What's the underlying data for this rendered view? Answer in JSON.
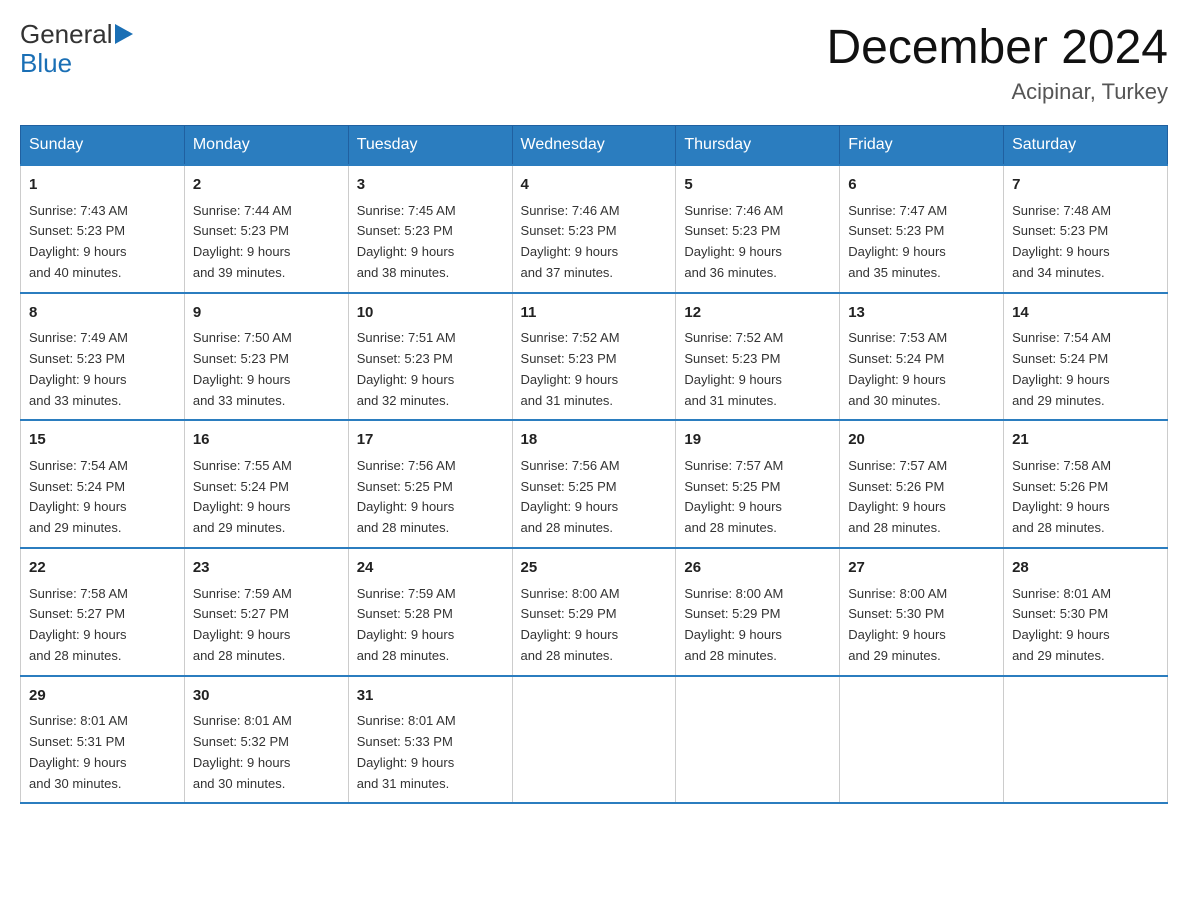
{
  "header": {
    "logo_general": "General",
    "logo_blue": "Blue",
    "month_title": "December 2024",
    "location": "Acipinar, Turkey"
  },
  "days_of_week": [
    "Sunday",
    "Monday",
    "Tuesday",
    "Wednesday",
    "Thursday",
    "Friday",
    "Saturday"
  ],
  "weeks": [
    [
      {
        "day": "1",
        "sunrise": "7:43 AM",
        "sunset": "5:23 PM",
        "daylight": "9 hours and 40 minutes."
      },
      {
        "day": "2",
        "sunrise": "7:44 AM",
        "sunset": "5:23 PM",
        "daylight": "9 hours and 39 minutes."
      },
      {
        "day": "3",
        "sunrise": "7:45 AM",
        "sunset": "5:23 PM",
        "daylight": "9 hours and 38 minutes."
      },
      {
        "day": "4",
        "sunrise": "7:46 AM",
        "sunset": "5:23 PM",
        "daylight": "9 hours and 37 minutes."
      },
      {
        "day": "5",
        "sunrise": "7:46 AM",
        "sunset": "5:23 PM",
        "daylight": "9 hours and 36 minutes."
      },
      {
        "day": "6",
        "sunrise": "7:47 AM",
        "sunset": "5:23 PM",
        "daylight": "9 hours and 35 minutes."
      },
      {
        "day": "7",
        "sunrise": "7:48 AM",
        "sunset": "5:23 PM",
        "daylight": "9 hours and 34 minutes."
      }
    ],
    [
      {
        "day": "8",
        "sunrise": "7:49 AM",
        "sunset": "5:23 PM",
        "daylight": "9 hours and 33 minutes."
      },
      {
        "day": "9",
        "sunrise": "7:50 AM",
        "sunset": "5:23 PM",
        "daylight": "9 hours and 33 minutes."
      },
      {
        "day": "10",
        "sunrise": "7:51 AM",
        "sunset": "5:23 PM",
        "daylight": "9 hours and 32 minutes."
      },
      {
        "day": "11",
        "sunrise": "7:52 AM",
        "sunset": "5:23 PM",
        "daylight": "9 hours and 31 minutes."
      },
      {
        "day": "12",
        "sunrise": "7:52 AM",
        "sunset": "5:23 PM",
        "daylight": "9 hours and 31 minutes."
      },
      {
        "day": "13",
        "sunrise": "7:53 AM",
        "sunset": "5:24 PM",
        "daylight": "9 hours and 30 minutes."
      },
      {
        "day": "14",
        "sunrise": "7:54 AM",
        "sunset": "5:24 PM",
        "daylight": "9 hours and 29 minutes."
      }
    ],
    [
      {
        "day": "15",
        "sunrise": "7:54 AM",
        "sunset": "5:24 PM",
        "daylight": "9 hours and 29 minutes."
      },
      {
        "day": "16",
        "sunrise": "7:55 AM",
        "sunset": "5:24 PM",
        "daylight": "9 hours and 29 minutes."
      },
      {
        "day": "17",
        "sunrise": "7:56 AM",
        "sunset": "5:25 PM",
        "daylight": "9 hours and 28 minutes."
      },
      {
        "day": "18",
        "sunrise": "7:56 AM",
        "sunset": "5:25 PM",
        "daylight": "9 hours and 28 minutes."
      },
      {
        "day": "19",
        "sunrise": "7:57 AM",
        "sunset": "5:25 PM",
        "daylight": "9 hours and 28 minutes."
      },
      {
        "day": "20",
        "sunrise": "7:57 AM",
        "sunset": "5:26 PM",
        "daylight": "9 hours and 28 minutes."
      },
      {
        "day": "21",
        "sunrise": "7:58 AM",
        "sunset": "5:26 PM",
        "daylight": "9 hours and 28 minutes."
      }
    ],
    [
      {
        "day": "22",
        "sunrise": "7:58 AM",
        "sunset": "5:27 PM",
        "daylight": "9 hours and 28 minutes."
      },
      {
        "day": "23",
        "sunrise": "7:59 AM",
        "sunset": "5:27 PM",
        "daylight": "9 hours and 28 minutes."
      },
      {
        "day": "24",
        "sunrise": "7:59 AM",
        "sunset": "5:28 PM",
        "daylight": "9 hours and 28 minutes."
      },
      {
        "day": "25",
        "sunrise": "8:00 AM",
        "sunset": "5:29 PM",
        "daylight": "9 hours and 28 minutes."
      },
      {
        "day": "26",
        "sunrise": "8:00 AM",
        "sunset": "5:29 PM",
        "daylight": "9 hours and 28 minutes."
      },
      {
        "day": "27",
        "sunrise": "8:00 AM",
        "sunset": "5:30 PM",
        "daylight": "9 hours and 29 minutes."
      },
      {
        "day": "28",
        "sunrise": "8:01 AM",
        "sunset": "5:30 PM",
        "daylight": "9 hours and 29 minutes."
      }
    ],
    [
      {
        "day": "29",
        "sunrise": "8:01 AM",
        "sunset": "5:31 PM",
        "daylight": "9 hours and 30 minutes."
      },
      {
        "day": "30",
        "sunrise": "8:01 AM",
        "sunset": "5:32 PM",
        "daylight": "9 hours and 30 minutes."
      },
      {
        "day": "31",
        "sunrise": "8:01 AM",
        "sunset": "5:33 PM",
        "daylight": "9 hours and 31 minutes."
      },
      null,
      null,
      null,
      null
    ]
  ],
  "labels": {
    "sunrise": "Sunrise:",
    "sunset": "Sunset:",
    "daylight": "Daylight:"
  }
}
